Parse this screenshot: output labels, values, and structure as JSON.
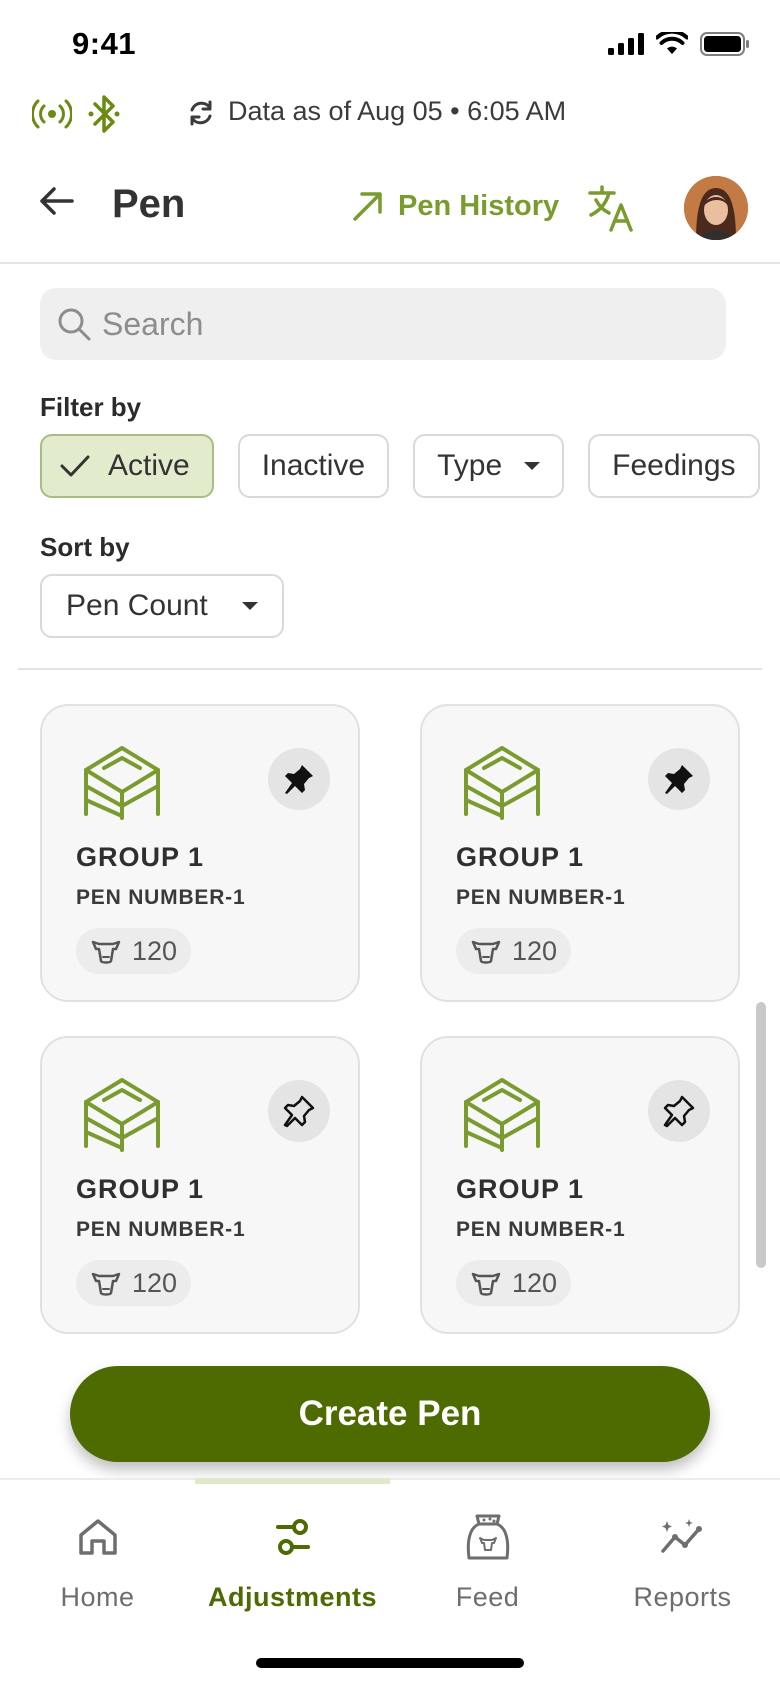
{
  "status_bar": {
    "time": "9:41"
  },
  "sync": {
    "text": "Data as of Aug 05 • 6:05 AM"
  },
  "header": {
    "title": "Pen",
    "history_label": "Pen History"
  },
  "search": {
    "placeholder": "Search",
    "value": ""
  },
  "filter": {
    "label": "Filter by",
    "chips": [
      {
        "label": "Active",
        "selected": true
      },
      {
        "label": "Inactive",
        "selected": false
      },
      {
        "label": "Type",
        "selected": false
      },
      {
        "label": "Feedings",
        "selected": false
      }
    ]
  },
  "sort": {
    "label": "Sort by",
    "value": "Pen Count"
  },
  "pens": [
    {
      "group": "GROUP 1",
      "pen_number": "PEN NUMBER-1",
      "count": "120",
      "pinned": true
    },
    {
      "group": "GROUP 1",
      "pen_number": "PEN NUMBER-1",
      "count": "120",
      "pinned": true
    },
    {
      "group": "GROUP 1",
      "pen_number": "PEN NUMBER-1",
      "count": "120",
      "pinned": false
    },
    {
      "group": "GROUP 1",
      "pen_number": "PEN NUMBER-1",
      "count": "120",
      "pinned": false
    }
  ],
  "create_button": {
    "label": "Create Pen"
  },
  "nav": {
    "items": [
      {
        "label": "Home",
        "icon": "home-icon",
        "active": false
      },
      {
        "label": "Adjustments",
        "icon": "adjustments-icon",
        "active": true
      },
      {
        "label": "Feed",
        "icon": "feed-bag-icon",
        "active": false
      },
      {
        "label": "Reports",
        "icon": "reports-icon",
        "active": false
      }
    ]
  },
  "colors": {
    "brand": "#4d6b00",
    "accent": "#7a9b2e",
    "chip_active_bg": "#e2ebcb"
  }
}
